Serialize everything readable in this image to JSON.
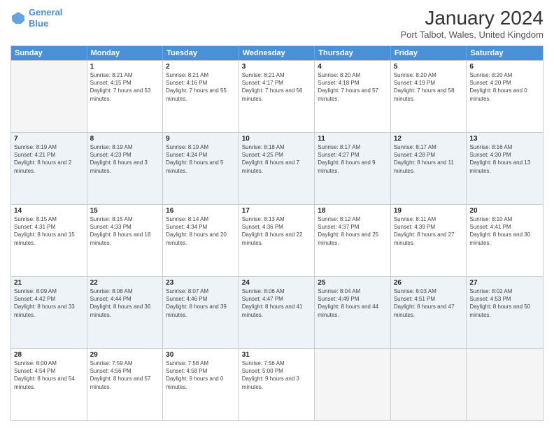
{
  "header": {
    "logo_line1": "General",
    "logo_line2": "Blue",
    "month": "January 2024",
    "location": "Port Talbot, Wales, United Kingdom"
  },
  "days": [
    "Sunday",
    "Monday",
    "Tuesday",
    "Wednesday",
    "Thursday",
    "Friday",
    "Saturday"
  ],
  "weeks": [
    [
      {
        "date": "",
        "sunrise": "",
        "sunset": "",
        "daylight": ""
      },
      {
        "date": "1",
        "sunrise": "Sunrise: 8:21 AM",
        "sunset": "Sunset: 4:15 PM",
        "daylight": "Daylight: 7 hours and 53 minutes."
      },
      {
        "date": "2",
        "sunrise": "Sunrise: 8:21 AM",
        "sunset": "Sunset: 4:16 PM",
        "daylight": "Daylight: 7 hours and 55 minutes."
      },
      {
        "date": "3",
        "sunrise": "Sunrise: 8:21 AM",
        "sunset": "Sunset: 4:17 PM",
        "daylight": "Daylight: 7 hours and 56 minutes."
      },
      {
        "date": "4",
        "sunrise": "Sunrise: 8:20 AM",
        "sunset": "Sunset: 4:18 PM",
        "daylight": "Daylight: 7 hours and 57 minutes."
      },
      {
        "date": "5",
        "sunrise": "Sunrise: 8:20 AM",
        "sunset": "Sunset: 4:19 PM",
        "daylight": "Daylight: 7 hours and 58 minutes."
      },
      {
        "date": "6",
        "sunrise": "Sunrise: 8:20 AM",
        "sunset": "Sunset: 4:20 PM",
        "daylight": "Daylight: 8 hours and 0 minutes."
      }
    ],
    [
      {
        "date": "7",
        "sunrise": "Sunrise: 8:19 AM",
        "sunset": "Sunset: 4:21 PM",
        "daylight": "Daylight: 8 hours and 2 minutes."
      },
      {
        "date": "8",
        "sunrise": "Sunrise: 8:19 AM",
        "sunset": "Sunset: 4:23 PM",
        "daylight": "Daylight: 8 hours and 3 minutes."
      },
      {
        "date": "9",
        "sunrise": "Sunrise: 8:19 AM",
        "sunset": "Sunset: 4:24 PM",
        "daylight": "Daylight: 8 hours and 5 minutes."
      },
      {
        "date": "10",
        "sunrise": "Sunrise: 8:18 AM",
        "sunset": "Sunset: 4:25 PM",
        "daylight": "Daylight: 8 hours and 7 minutes."
      },
      {
        "date": "11",
        "sunrise": "Sunrise: 8:17 AM",
        "sunset": "Sunset: 4:27 PM",
        "daylight": "Daylight: 8 hours and 9 minutes."
      },
      {
        "date": "12",
        "sunrise": "Sunrise: 8:17 AM",
        "sunset": "Sunset: 4:28 PM",
        "daylight": "Daylight: 8 hours and 11 minutes."
      },
      {
        "date": "13",
        "sunrise": "Sunrise: 8:16 AM",
        "sunset": "Sunset: 4:30 PM",
        "daylight": "Daylight: 8 hours and 13 minutes."
      }
    ],
    [
      {
        "date": "14",
        "sunrise": "Sunrise: 8:15 AM",
        "sunset": "Sunset: 4:31 PM",
        "daylight": "Daylight: 8 hours and 15 minutes."
      },
      {
        "date": "15",
        "sunrise": "Sunrise: 8:15 AM",
        "sunset": "Sunset: 4:33 PM",
        "daylight": "Daylight: 8 hours and 18 minutes."
      },
      {
        "date": "16",
        "sunrise": "Sunrise: 8:14 AM",
        "sunset": "Sunset: 4:34 PM",
        "daylight": "Daylight: 8 hours and 20 minutes."
      },
      {
        "date": "17",
        "sunrise": "Sunrise: 8:13 AM",
        "sunset": "Sunset: 4:36 PM",
        "daylight": "Daylight: 8 hours and 22 minutes."
      },
      {
        "date": "18",
        "sunrise": "Sunrise: 8:12 AM",
        "sunset": "Sunset: 4:37 PM",
        "daylight": "Daylight: 8 hours and 25 minutes."
      },
      {
        "date": "19",
        "sunrise": "Sunrise: 8:11 AM",
        "sunset": "Sunset: 4:39 PM",
        "daylight": "Daylight: 8 hours and 27 minutes."
      },
      {
        "date": "20",
        "sunrise": "Sunrise: 8:10 AM",
        "sunset": "Sunset: 4:41 PM",
        "daylight": "Daylight: 8 hours and 30 minutes."
      }
    ],
    [
      {
        "date": "21",
        "sunrise": "Sunrise: 8:09 AM",
        "sunset": "Sunset: 4:42 PM",
        "daylight": "Daylight: 8 hours and 33 minutes."
      },
      {
        "date": "22",
        "sunrise": "Sunrise: 8:08 AM",
        "sunset": "Sunset: 4:44 PM",
        "daylight": "Daylight: 8 hours and 36 minutes."
      },
      {
        "date": "23",
        "sunrise": "Sunrise: 8:07 AM",
        "sunset": "Sunset: 4:46 PM",
        "daylight": "Daylight: 8 hours and 39 minutes."
      },
      {
        "date": "24",
        "sunrise": "Sunrise: 8:06 AM",
        "sunset": "Sunset: 4:47 PM",
        "daylight": "Daylight: 8 hours and 41 minutes."
      },
      {
        "date": "25",
        "sunrise": "Sunrise: 8:04 AM",
        "sunset": "Sunset: 4:49 PM",
        "daylight": "Daylight: 8 hours and 44 minutes."
      },
      {
        "date": "26",
        "sunrise": "Sunrise: 8:03 AM",
        "sunset": "Sunset: 4:51 PM",
        "daylight": "Daylight: 8 hours and 47 minutes."
      },
      {
        "date": "27",
        "sunrise": "Sunrise: 8:02 AM",
        "sunset": "Sunset: 4:53 PM",
        "daylight": "Daylight: 8 hours and 50 minutes."
      }
    ],
    [
      {
        "date": "28",
        "sunrise": "Sunrise: 8:00 AM",
        "sunset": "Sunset: 4:54 PM",
        "daylight": "Daylight: 8 hours and 54 minutes."
      },
      {
        "date": "29",
        "sunrise": "Sunrise: 7:59 AM",
        "sunset": "Sunset: 4:56 PM",
        "daylight": "Daylight: 8 hours and 57 minutes."
      },
      {
        "date": "30",
        "sunrise": "Sunrise: 7:58 AM",
        "sunset": "Sunset: 4:58 PM",
        "daylight": "Daylight: 9 hours and 0 minutes."
      },
      {
        "date": "31",
        "sunrise": "Sunrise: 7:56 AM",
        "sunset": "Sunset: 5:00 PM",
        "daylight": "Daylight: 9 hours and 3 minutes."
      },
      {
        "date": "",
        "sunrise": "",
        "sunset": "",
        "daylight": ""
      },
      {
        "date": "",
        "sunrise": "",
        "sunset": "",
        "daylight": ""
      },
      {
        "date": "",
        "sunrise": "",
        "sunset": "",
        "daylight": ""
      }
    ]
  ]
}
